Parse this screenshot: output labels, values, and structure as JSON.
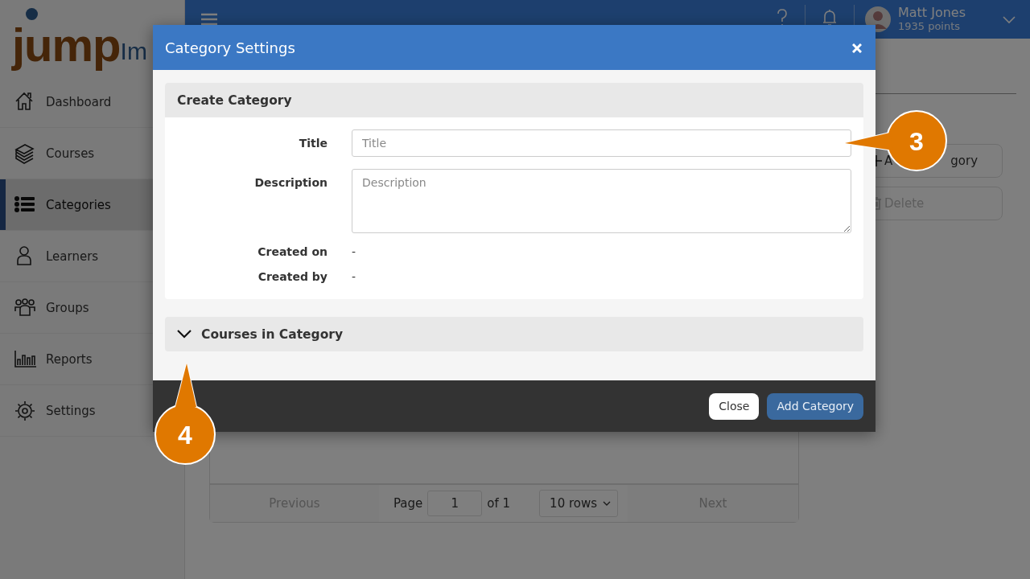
{
  "sidebar": {
    "logo": {
      "text": "jump",
      "text_2": "Im"
    },
    "items": [
      {
        "label": "Dashboard",
        "kind": "home",
        "selected": false
      },
      {
        "label": "Courses",
        "kind": "courses",
        "selected": false
      },
      {
        "label": "Categories",
        "kind": "categories",
        "selected": true
      },
      {
        "label": "Learners",
        "kind": "learners",
        "selected": false
      },
      {
        "label": "Groups",
        "kind": "groups",
        "selected": false
      },
      {
        "label": "Reports",
        "kind": "reports",
        "selected": false
      },
      {
        "label": "Settings",
        "kind": "settings",
        "selected": false
      }
    ]
  },
  "topbar": {
    "user": {
      "name": "Matt Jones",
      "points": "1935 points"
    }
  },
  "main": {
    "actions": [
      {
        "kind": "add",
        "label_start": "A",
        "label_end": "gory",
        "disabled": false
      },
      {
        "kind": "delete",
        "label": "Delete",
        "disabled": true
      }
    ],
    "pagination": {
      "previous": "Previous",
      "page_label": "Page",
      "page": "1",
      "of": "of 1",
      "rows": "10 rows",
      "next": "Next"
    }
  },
  "modal": {
    "title": "Category Settings",
    "section": {
      "title": "Create Category",
      "fields": [
        {
          "label": "Title",
          "kind": "input",
          "placeholder": "Title"
        },
        {
          "label": "Description",
          "kind": "textarea",
          "placeholder": "Description"
        },
        {
          "label": "Created on",
          "kind": "text",
          "value": "-"
        },
        {
          "label": "Created by",
          "kind": "text",
          "value": "-"
        }
      ]
    },
    "collapsible": {
      "title": "Courses in Category",
      "expanded": false
    },
    "buttons": [
      {
        "label": "Close",
        "kind": "secondary"
      },
      {
        "label": "Add Category",
        "kind": "primary"
      }
    ]
  },
  "callouts": [
    {
      "number": "3"
    },
    {
      "number": "4"
    }
  ]
}
